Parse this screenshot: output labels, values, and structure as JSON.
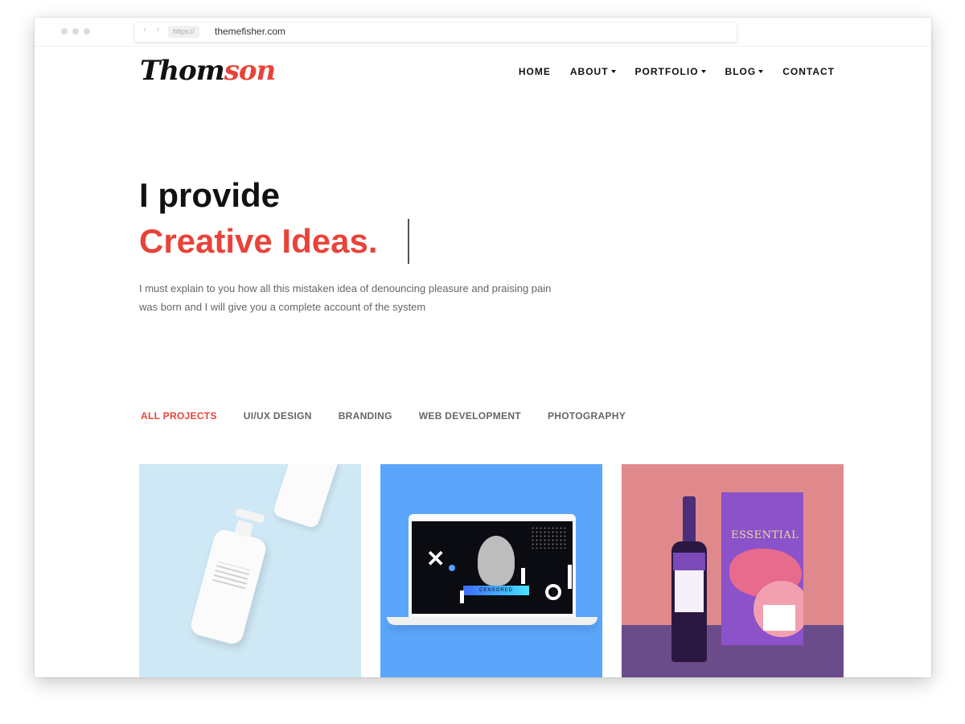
{
  "browser": {
    "scheme": "https://",
    "domain": "themefisher.com"
  },
  "site": {
    "logo": {
      "part1": "Thom",
      "part2": "son"
    },
    "nav": [
      {
        "label": "HOME",
        "dropdown": false
      },
      {
        "label": "ABOUT",
        "dropdown": true
      },
      {
        "label": "PORTFOLIO",
        "dropdown": true
      },
      {
        "label": "BLOG",
        "dropdown": true
      },
      {
        "label": "CONTACT",
        "dropdown": false
      }
    ]
  },
  "hero": {
    "line1": "I provide",
    "line2": "Creative Ideas.",
    "description": "I must explain to you how all this mistaken idea of denouncing pleasure and praising pain was born and I will give you a complete account of the system"
  },
  "filters": [
    {
      "label": "ALL PROJECTS",
      "active": true
    },
    {
      "label": "UI/UX DESIGN",
      "active": false
    },
    {
      "label": "BRANDING",
      "active": false
    },
    {
      "label": "WEB DEVELOPMENT",
      "active": false
    },
    {
      "label": "PHOTOGRAPHY",
      "active": false
    }
  ],
  "portfolio": {
    "card2_badge": "CENSORED",
    "card3_title": "ESSENTIAL"
  },
  "colors": {
    "accent": "#e8433a",
    "text": "#111111",
    "muted": "#666666"
  }
}
